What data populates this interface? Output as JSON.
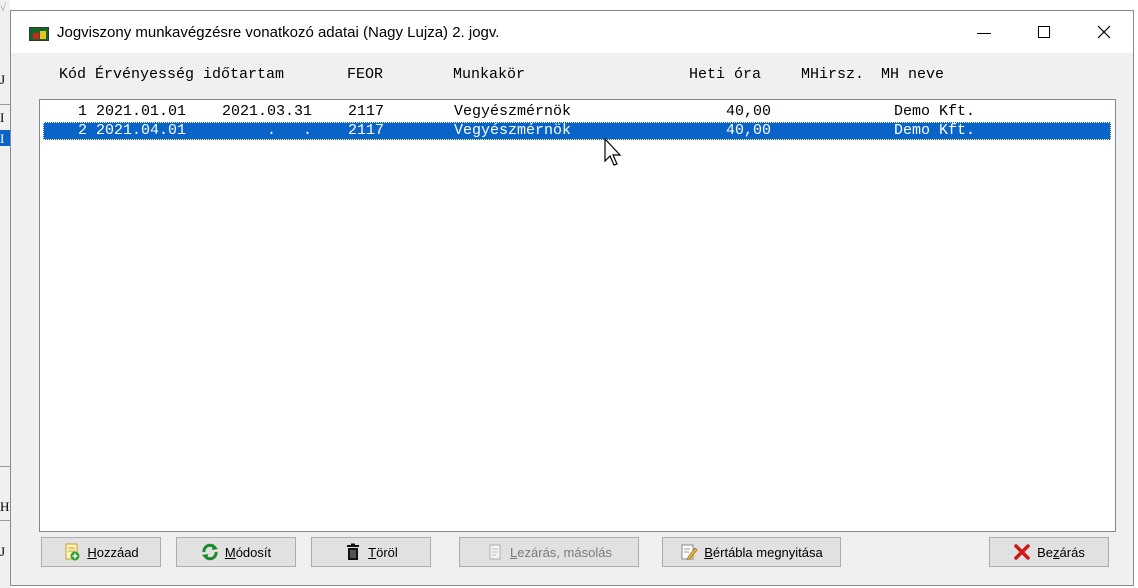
{
  "background": {
    "chars": [
      "√",
      "J",
      "I",
      "I",
      "H",
      "J"
    ]
  },
  "window": {
    "title": "Jogviszony munkavégzésre vonatkozó adatai (Nagy Lujza) 2. jogv.",
    "minimize_label": "—",
    "close_label": "✕"
  },
  "table": {
    "columns": [
      "Kód",
      "Érvényesség időtartam",
      "FEOR",
      "Munkakör",
      "Heti óra",
      "MHirsz.",
      "MH neve"
    ],
    "rows": [
      {
        "kod": "1",
        "kezdet": "2021.01.01",
        "veg": "2021.03.31",
        "feor": "2117",
        "munkakor": "Vegyészmérnök",
        "heti_ora": "40,00",
        "mhirsz": "",
        "mh_neve": "Demo Kft."
      },
      {
        "kod": "2",
        "kezdet": "2021.04.01",
        "veg": ".   .",
        "feor": "2117",
        "munkakor": "Vegyészmérnök",
        "heti_ora": "40,00",
        "mhirsz": "",
        "mh_neve": "Demo Kft."
      }
    ],
    "selected_row": 2
  },
  "buttons": {
    "add": {
      "label_u": "H",
      "label_rest": "ozzáad"
    },
    "modify": {
      "label_u": "M",
      "label_rest": "ódosít"
    },
    "delete": {
      "label_u": "T",
      "label_rest": "öröl"
    },
    "close_copy": {
      "label_u": "L",
      "label_rest": "ezárás, másolás"
    },
    "wage_table": {
      "label_u": "B",
      "label_rest": "értábla megnyitása"
    },
    "close": {
      "label_pre": "Be",
      "label_u": "z",
      "label_rest": "árás"
    }
  },
  "colors": {
    "selection": "#0a64c8",
    "window_bg": "#f0f0f0"
  },
  "icons": [
    "app-icon",
    "add-icon",
    "refresh-icon",
    "trash-icon",
    "copy-icon",
    "edit-icon",
    "close-x-icon",
    "mouse-cursor-icon"
  ]
}
